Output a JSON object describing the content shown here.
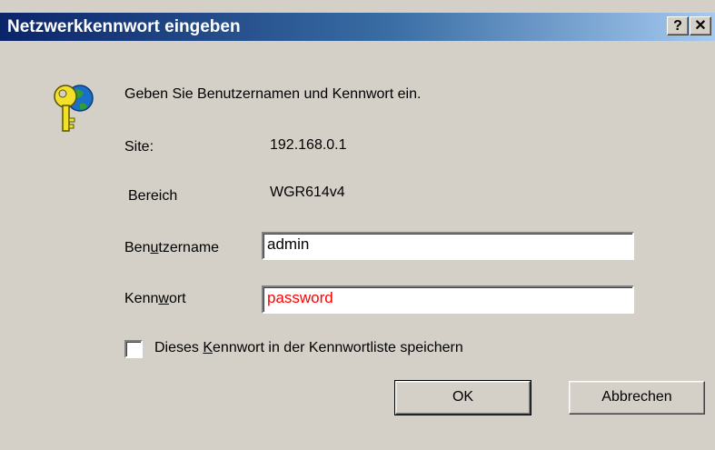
{
  "title_bar": {
    "title": "Netzwerkkennwort eingeben",
    "help_label": "?",
    "close_label": "✕"
  },
  "message": "Geben Sie Benutzernamen und Kennwort ein.",
  "site": {
    "label": "Site:",
    "value": "192.168.0.1"
  },
  "realm": {
    "label": "Bereich",
    "value": "WGR614v4"
  },
  "username": {
    "label_pre": "Ben",
    "label_access": "u",
    "label_post": "tzername",
    "value": "admin"
  },
  "password": {
    "label_pre": "Kenn",
    "label_access": "w",
    "label_post": "ort",
    "value": "password",
    "value_color": "#ff0000"
  },
  "save_password": {
    "label_pre": "Dieses ",
    "label_access": "K",
    "label_post": "ennwort in der Kennwortliste speichern",
    "checked": false
  },
  "buttons": {
    "ok": "OK",
    "cancel": "Abbrechen"
  },
  "icons": {
    "dialog_icon": "key-globe-icon"
  },
  "colors": {
    "titlebar_start": "#0a246a",
    "titlebar_end": "#a6caf0",
    "face": "#d4d0c8"
  }
}
